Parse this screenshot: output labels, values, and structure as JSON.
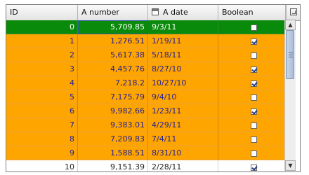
{
  "columns": {
    "id": "ID",
    "number": "A number",
    "date": "A date",
    "bool": "Boolean"
  },
  "icons": {
    "date_header": "calendar-icon",
    "corner": "column-control-icon",
    "scroll_up": "arrow-up-icon",
    "scroll_down": "arrow-down-icon"
  },
  "colors": {
    "selected_row": "#0a8a0a",
    "highlight_row": "#ffa500",
    "plain_row": "#ffffff",
    "orange_text": "#1f1f9a"
  },
  "scrollbar": {
    "up_glyph": "▲",
    "down_glyph": "▼"
  },
  "rows": [
    {
      "id": "0",
      "number": "5,709.85",
      "date": "9/3/11",
      "bool": false,
      "style": "sel"
    },
    {
      "id": "1",
      "number": "1,276.51",
      "date": "1/19/11",
      "bool": true,
      "style": "orange"
    },
    {
      "id": "2",
      "number": "5,617.38",
      "date": "5/18/11",
      "bool": false,
      "style": "orange"
    },
    {
      "id": "3",
      "number": "4,457.76",
      "date": "8/27/10",
      "bool": true,
      "style": "orange"
    },
    {
      "id": "4",
      "number": "7,218.2",
      "date": "10/27/10",
      "bool": true,
      "style": "orange"
    },
    {
      "id": "5",
      "number": "7,175.79",
      "date": "9/4/10",
      "bool": false,
      "style": "orange"
    },
    {
      "id": "6",
      "number": "9,982.66",
      "date": "1/23/11",
      "bool": true,
      "style": "orange"
    },
    {
      "id": "7",
      "number": "9,383.01",
      "date": "4/29/11",
      "bool": false,
      "style": "orange"
    },
    {
      "id": "8",
      "number": "7,209.83",
      "date": "7/4/11",
      "bool": false,
      "style": "orange"
    },
    {
      "id": "9",
      "number": "1,588.51",
      "date": "8/31/10",
      "bool": false,
      "style": "orange"
    },
    {
      "id": "10",
      "number": "9,151.39",
      "date": "2/28/11",
      "bool": true,
      "style": "plain"
    }
  ]
}
